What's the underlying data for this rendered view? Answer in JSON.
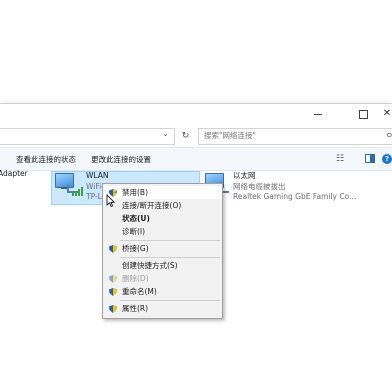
{
  "window": {
    "controls": {
      "minimize": "─",
      "maximize": "☐",
      "close": "✕"
    }
  },
  "address_bar": {
    "dropdown_icon": "chevron-down-icon",
    "refresh_icon": "refresh-icon",
    "search_placeholder": "搜索\"网络连接\"",
    "search_icon": "search-icon"
  },
  "toolbar": {
    "view_status": "查看此连接的状态",
    "change_settings": "更改此连接的设置",
    "help": "?"
  },
  "connections": [
    {
      "name": "Adapter",
      "subtitle": "",
      "detail": ""
    },
    {
      "name": "WLAN",
      "subtitle": "WiFi-Lincoln-5G",
      "detail": "TP-Link Wireless"
    },
    {
      "name": "以太网",
      "subtitle": "网络电缆被拔出",
      "detail": "Realtek Gaming GbE Family Co..."
    }
  ],
  "context_menu": {
    "items": [
      {
        "label": "禁用(B)",
        "shield": true,
        "state": "highlight"
      },
      {
        "label": "连接/断开连接(O)",
        "shield": false,
        "state": "normal"
      },
      {
        "label": "状态(U)",
        "shield": false,
        "state": "bold"
      },
      {
        "label": "诊断(I)",
        "shield": false,
        "state": "normal"
      },
      {
        "label": "桥接(G)",
        "shield": true,
        "state": "normal"
      },
      {
        "label": "创建快捷方式(S)",
        "shield": false,
        "state": "normal"
      },
      {
        "label": "删除(D)",
        "shield": true,
        "state": "disabled"
      },
      {
        "label": "重命名(M)",
        "shield": true,
        "state": "normal"
      },
      {
        "label": "属性(R)",
        "shield": true,
        "state": "normal"
      }
    ]
  },
  "colors": {
    "selection": "#cce8ff",
    "shield_blue": "#1e5fbf",
    "shield_yellow": "#f4c20d",
    "signal_green": "#3aa53a"
  }
}
